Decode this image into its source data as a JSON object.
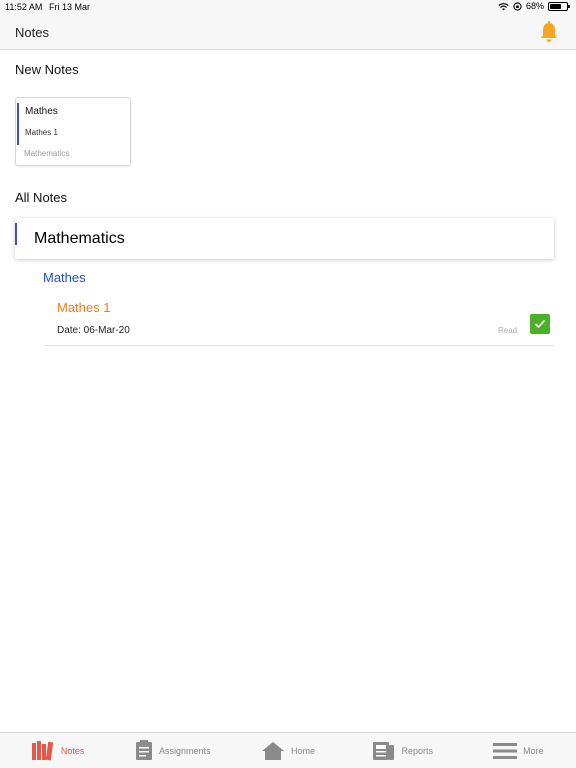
{
  "status_bar": {
    "time": "11:52 AM",
    "date": "Fri 13 Mar",
    "battery": "68%",
    "battery_level": 0.68
  },
  "header": {
    "title": "Notes",
    "bell_icon": "bell-icon",
    "bell_color": "#f5a623"
  },
  "new_notes": {
    "heading": "New Notes",
    "cards": [
      {
        "subject": "Mathes",
        "title": "Mathes 1",
        "category": "Mathematics"
      }
    ]
  },
  "all_notes": {
    "heading": "All Notes",
    "subjects": [
      {
        "name": "Mathematics",
        "groups": [
          {
            "name": "Mathes",
            "notes": [
              {
                "title": "Mathes 1",
                "date": "Date: 06-Mar-20",
                "status": "Read",
                "checked": true
              }
            ]
          }
        ]
      }
    ]
  },
  "tab_bar": {
    "active_color": "#e8574a",
    "tabs": [
      {
        "label": "Notes",
        "icon": "books-icon",
        "active": true
      },
      {
        "label": "Assignments",
        "icon": "clipboard-icon",
        "active": false
      },
      {
        "label": "Home",
        "icon": "home-icon",
        "active": false
      },
      {
        "label": "Reports",
        "icon": "report-icon",
        "active": false
      },
      {
        "label": "More",
        "icon": "menu-icon",
        "active": false
      }
    ]
  }
}
